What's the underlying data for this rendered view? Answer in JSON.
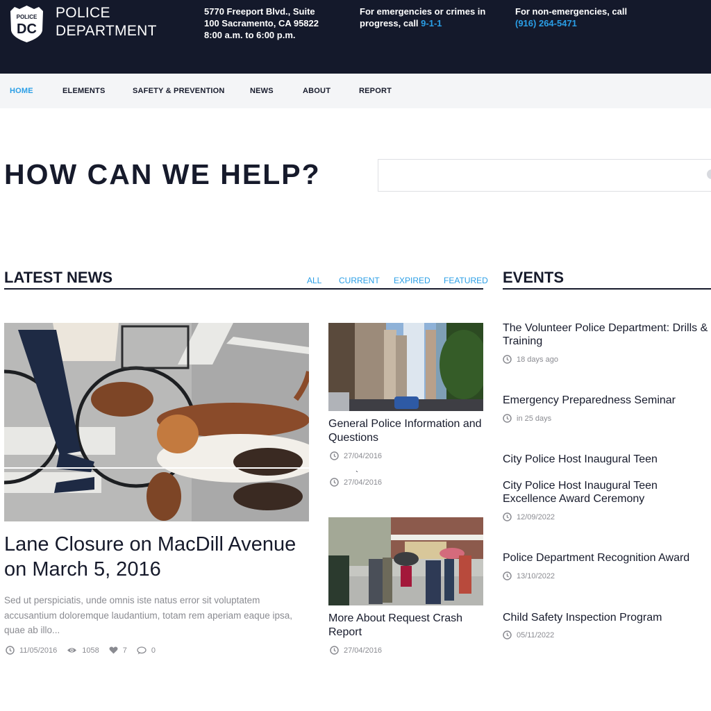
{
  "header": {
    "logo": {
      "top_text": "POLICE",
      "main_text": "DC",
      "icon": "police-badge-icon"
    },
    "brand_line1": "POLICE",
    "brand_line2": "DEPARTMENT",
    "address": {
      "line1": "5770 Freeport Blvd., Suite",
      "line2": "100 Sacramento, CA 95822",
      "hours": "8:00 a.m. to 6:00 p.m."
    },
    "emergency": {
      "text_line1": "For emergencies or crimes in",
      "text_line2": "progress, call ",
      "phone": "9-1-1"
    },
    "non_emergency": {
      "text": "For non-emergencies, call",
      "phone": "(916) 264-5471"
    }
  },
  "nav": {
    "items": [
      {
        "label": "HOME",
        "active": true
      },
      {
        "label": "ELEMENTS",
        "active": false
      },
      {
        "label": "SAFETY & PREVENTION",
        "active": false
      },
      {
        "label": "NEWS",
        "active": false
      },
      {
        "label": "ABOUT",
        "active": false
      },
      {
        "label": "REPORT",
        "active": false
      }
    ]
  },
  "help": {
    "title": "HOW CAN WE HELP?",
    "search_value": "",
    "search_placeholder": ""
  },
  "latest_news": {
    "title": "LATEST NEWS",
    "filters": [
      "ALL",
      "CURRENT",
      "EXPIRED",
      "FEATURED"
    ],
    "featured": {
      "image": "cyclist-with-dogs-photo",
      "title": "Lane Closure on MacDill Avenue on March 5, 2016",
      "excerpt": "Sed ut perspiciatis, unde omnis iste natus error sit voluptatem accusantium doloremque laudantium, totam rem aperiam eaque ipsa, quae ab illo...",
      "date": "11/05/2016",
      "views": "1058",
      "likes": "7",
      "comments": "0"
    },
    "side_articles": [
      {
        "image": "city-street-photo",
        "title": "General Police Information and Questions",
        "date": "27/04/2016",
        "extra_date": "27/04/2016",
        "stray_mark": "`"
      },
      {
        "image": "pedestrians-crossing-photo",
        "title": "More About Request Crash Report",
        "date": "27/04/2016"
      }
    ]
  },
  "events": {
    "title": "EVENTS",
    "items": [
      {
        "title": "The Volunteer Police Department: Drills & Training",
        "time": "18 days ago"
      },
      {
        "title": "Emergency Preparedness Seminar",
        "time": "in 25 days"
      },
      {
        "title": "City Police Host Inaugural Teen",
        "time": null
      },
      {
        "title": "City Police Host Inaugural Teen Excellence Award Ceremony",
        "time": "12/09/2022"
      },
      {
        "title": "Police Department Recognition Award",
        "time": "13/10/2022"
      },
      {
        "title": "Child Safety Inspection Program",
        "time": "05/11/2022"
      }
    ]
  },
  "colors": {
    "header_bg": "#14192b",
    "accent": "#2a9ee6",
    "nav_bg": "#f4f5f7",
    "text_dark": "#161a2b",
    "text_muted": "#8a8b91"
  }
}
